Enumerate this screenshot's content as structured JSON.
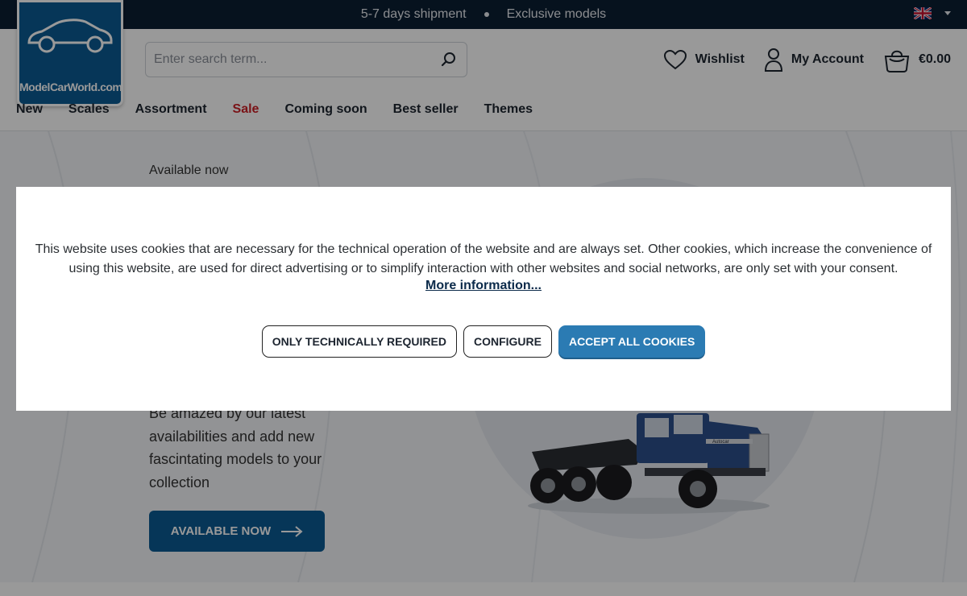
{
  "topbar": {
    "shipping": "5-7 days shipment",
    "exclusive": "Exclusive models",
    "language_icon": "uk-flag-icon"
  },
  "header": {
    "logo_text": "ModelCarWorld.com",
    "search_placeholder": "Enter search term...",
    "wishlist_label": "Wishlist",
    "account_label": "My Account",
    "cart_total": "€0.00"
  },
  "nav": {
    "items": [
      "New",
      "Scales",
      "Assortment",
      "Sale",
      "Coming soon",
      "Best seller",
      "Themes"
    ],
    "sale_color": "#cc2127"
  },
  "hero": {
    "eyebrow": "Available now",
    "subtitle": "Be amazed by our latest availabilities and add new fascintating models to your collection",
    "cta_label": "AVAILABLE NOW",
    "truck_badge": "Autocar"
  },
  "cookie_banner": {
    "message": "This website uses cookies that are necessary for the technical operation of the website and are always set. Other cookies, which increase the convenience of using this website, are used for direct advertising or to simplify interaction with other websites and social networks, are only set with your consent.",
    "more_info": "More information...",
    "buttons": {
      "technical": "ONLY TECHNICALLY REQUIRED",
      "configure": "CONFIGURE",
      "accept": "ACCEPT ALL COOKIES"
    }
  },
  "colors": {
    "topbar_bg": "#0b1e33",
    "brand_blue": "#0b5a93",
    "accept_button": "#2b7bb3"
  }
}
